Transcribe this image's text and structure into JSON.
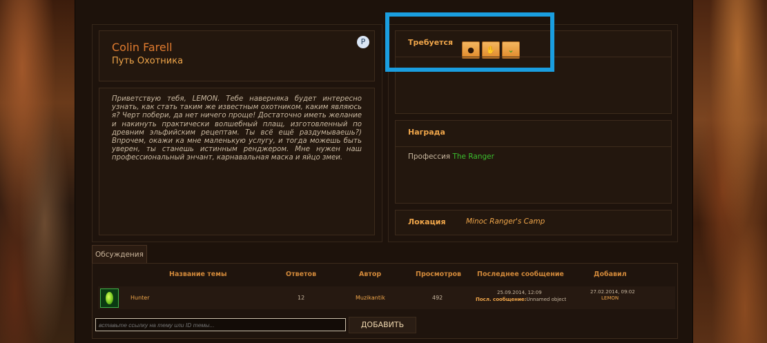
{
  "npc": {
    "name": "Colin Farell",
    "title": "Путь Охотника",
    "badge": "P",
    "quest_text": "Приветствую тебя, LEMON. Тебе наверняка будет интересно узнать, как стать таким же известным охотником, каким являюсь я? Черт побери, да нет ничего проще! Достаточно иметь желание и накинуть практически волшебный плащ, изготовленный по древним эльфийским рецептам. Ты всё ещё раздумываешь?) Впрочем, окажи ка мне маленькую услугу, и тогда можешь быть уверен, ты станешь истинным ренджером. Мне нужен наш профессиональный энчант, карнавальная маска и яйцо змеи."
  },
  "requirements": {
    "title": "Требуется",
    "items": [
      {
        "icon": "enchant-icon",
        "glyph": "●"
      },
      {
        "icon": "mask-icon",
        "glyph": "✋"
      },
      {
        "icon": "egg-icon",
        "glyph": "⌄"
      }
    ]
  },
  "reward": {
    "title": "Награда",
    "label": "Профессия",
    "value": "The Ranger"
  },
  "location": {
    "label": "Локация",
    "value": "Minoc Ranger's Camp"
  },
  "discussions": {
    "tab_label": "Обсуждения",
    "columns": [
      "Название темы",
      "Ответов",
      "Автор",
      "Просмотров",
      "Последнее сообщение",
      "Добавил"
    ],
    "rows": [
      {
        "topic": "Hunter",
        "replies": "12",
        "author": "Muzikantik",
        "views": "492",
        "last_date": "25.09.2014, 12:09",
        "last_label": "Посл. сообщение:",
        "last_object": "Unnamed object",
        "added_date": "27.02.2014, 09:02",
        "added_by": "LEMON"
      }
    ],
    "input_placeholder": "вставьте ссылку на тему или ID темы...",
    "add_button": "ДОБАВИТЬ"
  },
  "colors": {
    "accent": "#f0a64a",
    "name": "#e07b2f",
    "link_green": "#3bbf2e",
    "highlight": "#1a9ee0"
  }
}
